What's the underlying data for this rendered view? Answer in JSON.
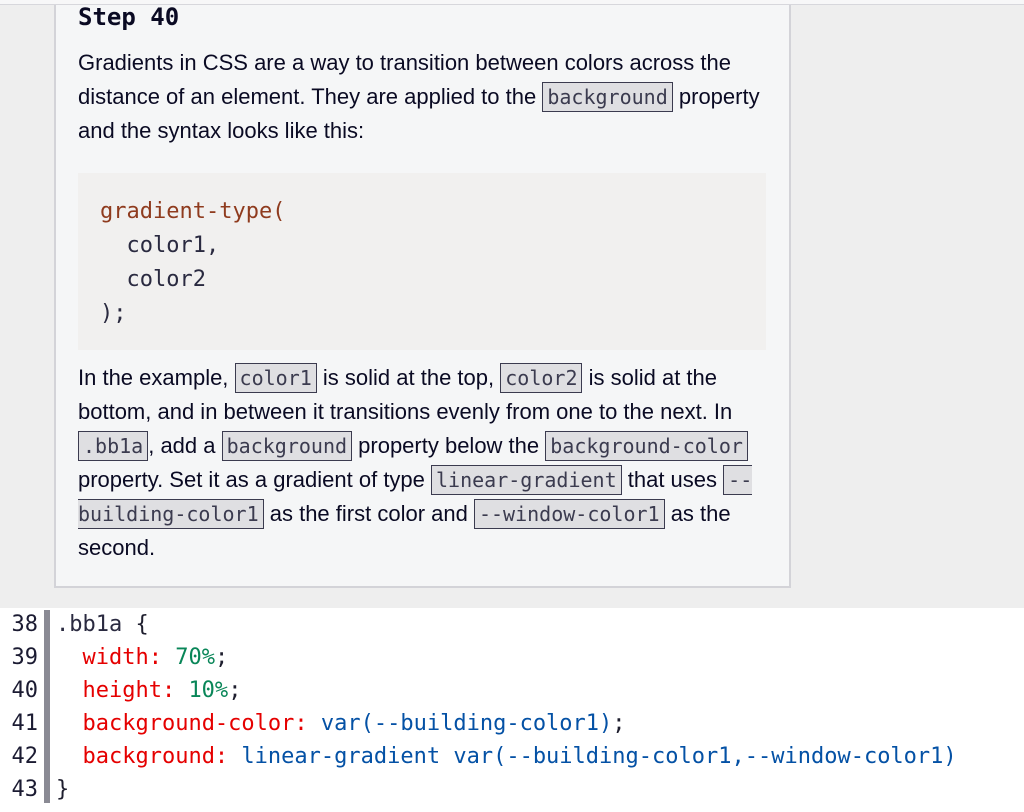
{
  "step": {
    "title": "Step 40"
  },
  "description": {
    "paragraph_1": [
      {
        "text": "Gradients in CSS are a way to transition between colors across the distance of an element. They are applied to the "
      },
      {
        "code": "background"
      },
      {
        "text": " property and the syntax looks like this:"
      }
    ],
    "example": {
      "opening": "gradient-type(",
      "arguments": [
        "color1,",
        "color2"
      ],
      "closing": ");"
    },
    "paragraph_2": [
      {
        "text": "In the example, "
      },
      {
        "code": "color1"
      },
      {
        "text": " is solid at the top, "
      },
      {
        "code": "color2"
      },
      {
        "text": " is solid at the bottom, and in between it transitions evenly from one to the next. In "
      },
      {
        "code": ".bb1a"
      },
      {
        "text": ", add a "
      },
      {
        "code": "background"
      },
      {
        "text": " property below the "
      },
      {
        "code": "background-color"
      },
      {
        "text": " property. Set it as a gradient of type "
      },
      {
        "code": "linear-gradient"
      },
      {
        "text": " that uses "
      },
      {
        "code": "--building-color1"
      },
      {
        "text": " as the first color and "
      },
      {
        "code": "--window-color1"
      },
      {
        "text": " as the second."
      }
    ]
  },
  "editor": {
    "lines": [
      {
        "number": 38,
        "selector": ".bb1a",
        "brace": "{"
      },
      {
        "number": 39,
        "property": "width:",
        "value": "70%",
        "terminator": ";"
      },
      {
        "number": 40,
        "property": "height:",
        "value": "10%",
        "terminator": ";"
      },
      {
        "number": 41,
        "property": "background-color:",
        "value": "var(--building-color1)",
        "terminator": ";"
      },
      {
        "number": 42,
        "property": "background:",
        "value": "linear-gradient var(--building-color1,--window-color1)"
      },
      {
        "number": 43,
        "brace": "}"
      }
    ]
  },
  "colors": {
    "selector": "#2a2a40",
    "property": "#e50000",
    "number": "#098658",
    "value": "#0451a5",
    "function": "#8f3b1e",
    "editable_region_marker": "#8a8a94",
    "inline_code_background": "#dfdfe2"
  }
}
